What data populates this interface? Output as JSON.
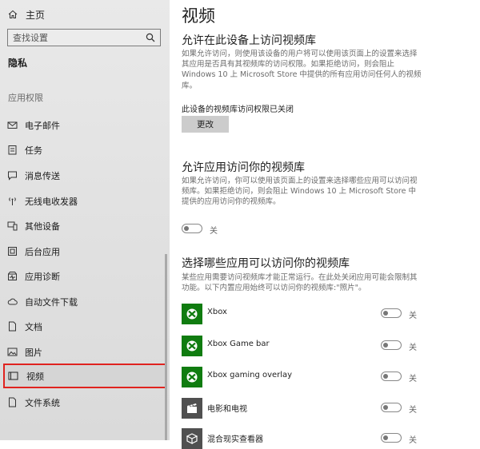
{
  "sidebar": {
    "home_label": "主页",
    "search_placeholder": "查找设置",
    "privacy_label": "隐私",
    "section_title": "应用权限",
    "items": [
      {
        "label": "电子邮件",
        "icon": "mail-icon"
      },
      {
        "label": "任务",
        "icon": "tasks-icon"
      },
      {
        "label": "消息传送",
        "icon": "chat-icon"
      },
      {
        "label": "无线电收发器",
        "icon": "radio-tower-icon"
      },
      {
        "label": "其他设备",
        "icon": "devices-icon"
      },
      {
        "label": "后台应用",
        "icon": "background-apps-icon"
      },
      {
        "label": "应用诊断",
        "icon": "diagnostics-icon"
      },
      {
        "label": "自动文件下载",
        "icon": "cloud-icon"
      },
      {
        "label": "文档",
        "icon": "document-icon"
      },
      {
        "label": "图片",
        "icon": "image-icon"
      },
      {
        "label": "视频",
        "icon": "video-icon",
        "active": true
      },
      {
        "label": "文件系统",
        "icon": "file-icon"
      }
    ]
  },
  "main": {
    "title": "视频",
    "section1": {
      "heading": "允许在此设备上访问视频库",
      "desc": "如果允许访问，则使用该设备的用户将可以使用该页面上的设置来选择其应用是否具有其视频库的访问权限。如果拒绝访问，则会阻止 Windows 10 上 Microsoft Store 中提供的所有应用访问任何人的视频库。",
      "status": "此设备的视频库访问权限已关闭",
      "button": "更改"
    },
    "section2": {
      "heading": "允许应用访问你的视频库",
      "desc": "如果允许访问，你可以使用该页面上的设置来选择哪些应用可以访问视频库。如果拒绝访问，则会阻止 Windows 10 上 Microsoft Store 中提供的应用访问你的视频库。",
      "toggle_label": "关"
    },
    "section3": {
      "heading": "选择哪些应用可以访问你的视频库",
      "desc": "某些应用需要访问视频库才能正常运行。在此处关闭应用可能会限制其功能。以下内置应用始终可以访问你的视频库:\"照片\"。",
      "apps": [
        {
          "name": "Xbox",
          "toggle_label": "关",
          "icon": "xbox-icon"
        },
        {
          "name": "Xbox Game bar",
          "toggle_label": "关",
          "icon": "xbox-icon"
        },
        {
          "name": "Xbox gaming overlay",
          "toggle_label": "关",
          "icon": "xbox-icon"
        },
        {
          "name": "电影和电视",
          "toggle_label": "关",
          "icon": "film-icon"
        },
        {
          "name": "混合现实查看器",
          "toggle_label": "关",
          "icon": "cube-icon"
        }
      ]
    }
  },
  "colors": {
    "highlight_border": "#e0231f",
    "xbox_green": "#107c10",
    "film_tile": "#505050"
  }
}
